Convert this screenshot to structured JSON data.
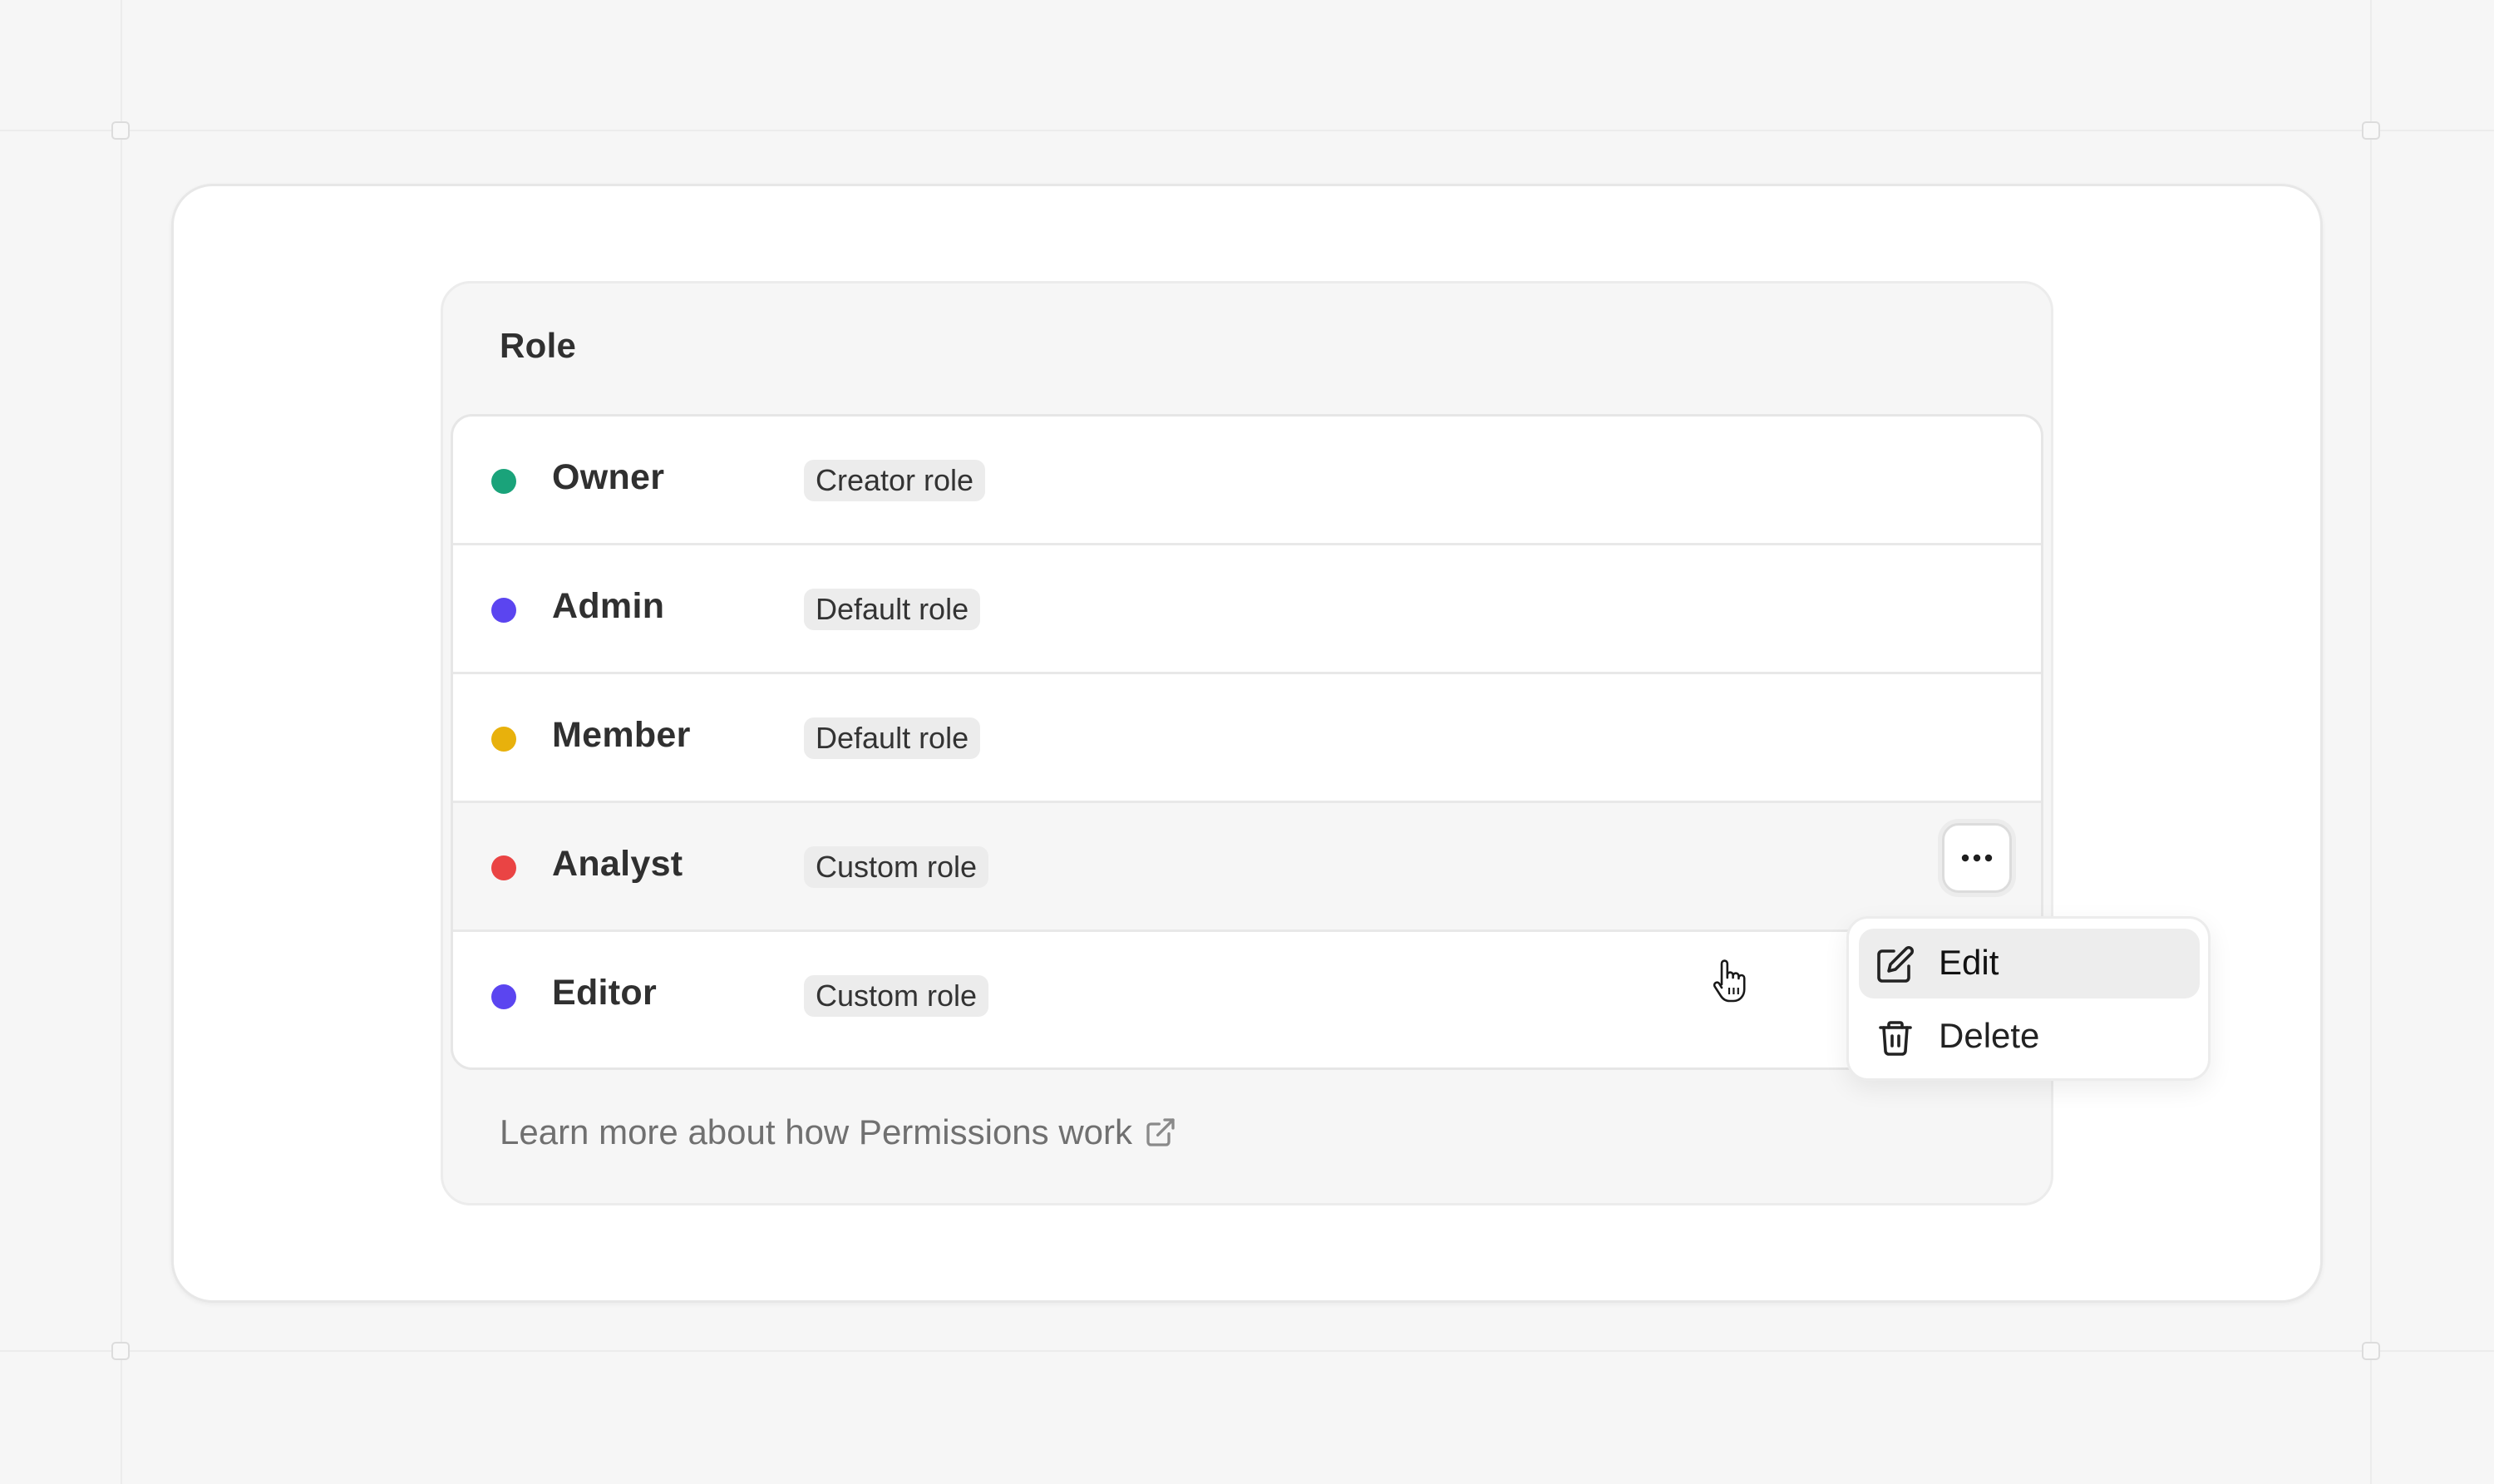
{
  "panel": {
    "header": "Role",
    "roles": [
      {
        "name": "Owner",
        "badge": "Creator role",
        "color": "#1aa37a"
      },
      {
        "name": "Admin",
        "badge": "Default role",
        "color": "#5b45f0"
      },
      {
        "name": "Member",
        "badge": "Default role",
        "color": "#e8b10c"
      },
      {
        "name": "Analyst",
        "badge": "Custom role",
        "color": "#ea4444"
      },
      {
        "name": "Editor",
        "badge": "Custom role",
        "color": "#5b45f0"
      }
    ],
    "hovered_row": "Analyst",
    "more_button_icon": "ellipsis-icon",
    "learn_more": {
      "text": "Learn more about how Permissions work",
      "icon": "external-link-icon"
    }
  },
  "context_menu": {
    "items": [
      {
        "label": "Edit",
        "icon": "edit-icon",
        "highlighted": true
      },
      {
        "label": "Delete",
        "icon": "trash-icon",
        "highlighted": false
      }
    ]
  },
  "cursor": {
    "type": "hand-pointer-icon"
  }
}
